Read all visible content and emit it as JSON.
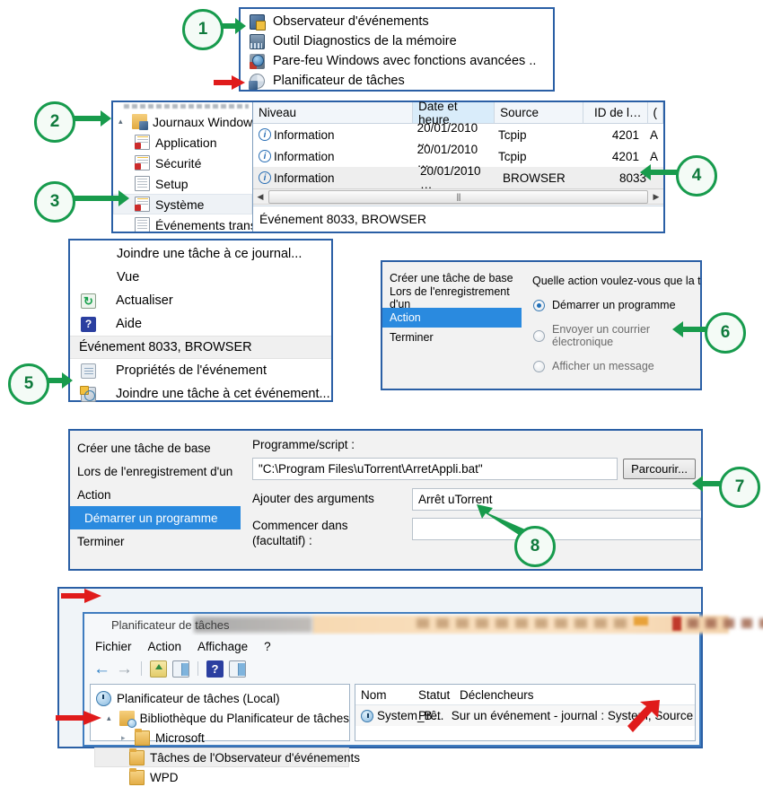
{
  "callouts": [
    "1",
    "2",
    "3",
    "4",
    "5",
    "6",
    "7",
    "8"
  ],
  "panel1": {
    "items": [
      {
        "icon": "event-viewer-icon",
        "label": "Observateur d'événements"
      },
      {
        "icon": "memory-diagnostics-icon",
        "label": "Outil Diagnostics de la mémoire"
      },
      {
        "icon": "windows-firewall-icon",
        "label": "Pare-feu Windows avec fonctions avancées .."
      },
      {
        "icon": "task-scheduler-icon",
        "label": "Planificateur de tâches"
      }
    ]
  },
  "panel2": {
    "tree": [
      {
        "label": "Affichages personnalisés",
        "level": 1,
        "icon": "folder-log-icon",
        "cut": true
      },
      {
        "label": "Journaux Windows",
        "level": 1,
        "icon": "folder-log-icon",
        "twisty": "▴"
      },
      {
        "label": "Application",
        "level": 2,
        "icon": "log-flag-icon"
      },
      {
        "label": "Sécurité",
        "level": 2,
        "icon": "log-flag-icon"
      },
      {
        "label": "Setup",
        "level": 2,
        "icon": "log-icon"
      },
      {
        "label": "Système",
        "level": 2,
        "icon": "log-flag-icon",
        "selected": true
      },
      {
        "label": "Événements transf",
        "level": 2,
        "icon": "log-icon"
      }
    ],
    "columns": [
      "Niveau",
      "Date et heure",
      "Source",
      "ID de l…",
      "("
    ],
    "rows": [
      {
        "level": "Information",
        "date": "20/01/2010 …",
        "source": "Tcpip",
        "id": "4201",
        "extra": "A"
      },
      {
        "level": "Information",
        "date": "20/01/2010 …",
        "source": "Tcpip",
        "id": "4201",
        "extra": "A"
      },
      {
        "level": "Information",
        "date": "20/01/2010 …",
        "source": "BROWSER",
        "id": "8033",
        "extra": "",
        "selected": true
      }
    ],
    "status": "Événement 8033, BROWSER"
  },
  "panel3": {
    "items": [
      {
        "label": "Joindre une tâche à ce journal...",
        "icon": null
      },
      {
        "label": "Vue",
        "icon": null
      },
      {
        "label": "Actualiser",
        "icon": "refresh-icon"
      },
      {
        "label": "Aide",
        "icon": "help-icon"
      },
      {
        "label": "Événement 8033, BROWSER",
        "icon": null,
        "header": true
      },
      {
        "label": "Propriétés de l'événement",
        "icon": "properties-icon"
      },
      {
        "label": "Joindre une tâche à cet événement...",
        "icon": "attach-task-icon"
      }
    ]
  },
  "panel4": {
    "steps": [
      {
        "label": "Créer une tâche de base",
        "active": false
      },
      {
        "label": "Lors de l'enregistrement d'un",
        "active": false
      },
      {
        "label": "Action",
        "active": true
      },
      {
        "label": "Terminer",
        "active": false
      }
    ],
    "question": "Quelle action voulez-vous que la tâch",
    "options": [
      {
        "label": "Démarrer un programme",
        "checked": true
      },
      {
        "label": "Envoyer un courrier électronique",
        "checked": false
      },
      {
        "label": "Afficher un message",
        "checked": false
      }
    ]
  },
  "panel5": {
    "steps": [
      {
        "label": "Créer une tâche de base",
        "active": false
      },
      {
        "label": "Lors de l'enregistrement d'un",
        "active": false
      },
      {
        "label": "Action",
        "active": false
      },
      {
        "label": "Démarrer un programme",
        "active": true
      },
      {
        "label": "Terminer",
        "active": false
      }
    ],
    "program_label": "Programme/script :",
    "program_value": "\"C:\\Program Files\\uTorrent\\ArretAppli.bat\"",
    "browse_button": "Parcourir...",
    "args_label": "Ajouter des arguments",
    "args_value": "Arrêt uTorrent",
    "startin_label_line1": "Commencer dans",
    "startin_label_line2": "(facultatif) :",
    "startin_value": ""
  },
  "panel6": {
    "window_title": "Planificateur de tâches",
    "menus": [
      "Fichier",
      "Action",
      "Affichage",
      "?"
    ],
    "toolbar_icons": [
      "back-icon",
      "forward-icon",
      "up-folder-icon",
      "show-pane-icon",
      "help-icon",
      "show-pane2-icon"
    ],
    "tree": [
      {
        "label": "Planificateur de tâches (Local)",
        "level": 1,
        "icon": "clock-icon"
      },
      {
        "label": "Bibliothèque du Planificateur de tâches",
        "level": 2,
        "icon": "library-icon",
        "twisty": "▴"
      },
      {
        "label": "Microsoft",
        "level": 3,
        "icon": "folder-icon",
        "twisty": "▸"
      },
      {
        "label": "Tâches de l'Observateur d'événements",
        "level": 3,
        "icon": "folder-icon",
        "highlighted": true
      },
      {
        "label": "WPD",
        "level": 3,
        "icon": "folder-icon"
      }
    ],
    "columns": [
      "Nom",
      "Statut",
      "Déclencheurs"
    ],
    "rows": [
      {
        "name": "System_B…",
        "status": "Prêt",
        "trigger": "Sur un événement - journal : System, Source : BROWSER,"
      }
    ]
  },
  "colors": {
    "callout_border": "#179b4d",
    "callout_text": "#0f7a3c",
    "green_arrow": "#189b4c",
    "red_arrow": "#e01b1b",
    "panel_border": "#2a5fa5",
    "selection_blue": "#2a8adf"
  }
}
